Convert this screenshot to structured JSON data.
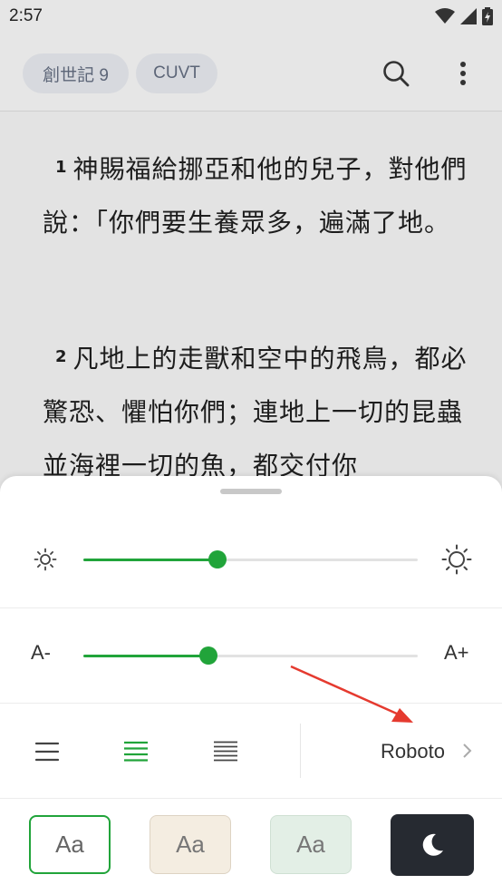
{
  "status_bar": {
    "time": "2:57"
  },
  "app_bar": {
    "book_chip": "創世記 9",
    "version_chip": "CUVT"
  },
  "reading": {
    "verses": [
      {
        "number": "1",
        "text": "神賜福給挪亞和他的兒子，對他們說：「你們要生養眾多，遍滿了地。"
      },
      {
        "number": "2",
        "text": "凡地上的走獸和空中的飛鳥，都必驚恐、懼怕你們；連地上一切的昆蟲並海裡一切的魚，都交付你"
      }
    ]
  },
  "settings": {
    "brightness": {
      "value": 0.4
    },
    "font_size": {
      "decrease_label": "A-",
      "increase_label": "A+",
      "value": 0.375
    },
    "alignment": {
      "options": [
        "align-left-icon",
        "align-justify-icon",
        "align-justify-dense-icon"
      ],
      "selected": 1
    },
    "font": {
      "name": "Roboto"
    },
    "themes": [
      {
        "label": "Aa",
        "name": "white",
        "selected": true
      },
      {
        "label": "Aa",
        "name": "sepia"
      },
      {
        "label": "Aa",
        "name": "green"
      },
      {
        "icon": "moon-icon",
        "name": "dark"
      }
    ],
    "accent_color": "#21a43a"
  }
}
